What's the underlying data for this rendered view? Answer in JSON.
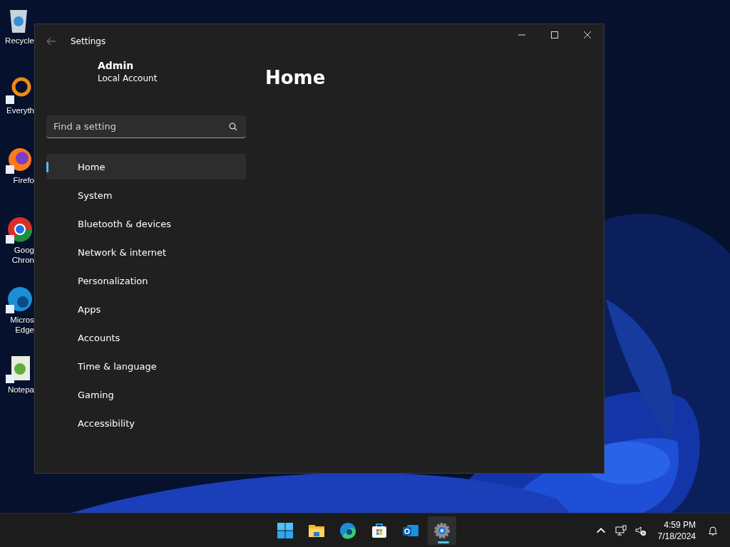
{
  "desktop_icons": [
    {
      "label": "Recycle",
      "kind": "bin"
    },
    {
      "label": "Everyth",
      "kind": "search"
    },
    {
      "label": "Firefo",
      "kind": "firefox"
    },
    {
      "label": "Goog Chron",
      "kind": "chrome"
    },
    {
      "label": "Micros Edge",
      "kind": "edge"
    },
    {
      "label": "Notepa",
      "kind": "notepad"
    }
  ],
  "window": {
    "title": "Settings",
    "user": {
      "name": "Admin",
      "account": "Local Account"
    },
    "search": {
      "placeholder": "Find a setting"
    },
    "nav": [
      {
        "label": "Home",
        "selected": true
      },
      {
        "label": "System",
        "selected": false
      },
      {
        "label": "Bluetooth & devices",
        "selected": false
      },
      {
        "label": "Network & internet",
        "selected": false
      },
      {
        "label": "Personalization",
        "selected": false
      },
      {
        "label": "Apps",
        "selected": false
      },
      {
        "label": "Accounts",
        "selected": false
      },
      {
        "label": "Time & language",
        "selected": false
      },
      {
        "label": "Gaming",
        "selected": false
      },
      {
        "label": "Accessibility",
        "selected": false
      }
    ],
    "page_title": "Home"
  },
  "taskbar": {
    "apps": [
      {
        "kind": "start",
        "selected": false
      },
      {
        "kind": "folder",
        "selected": false
      },
      {
        "kind": "edge",
        "selected": false
      },
      {
        "kind": "store",
        "selected": false
      },
      {
        "kind": "mail",
        "selected": false
      },
      {
        "kind": "settings",
        "selected": true
      }
    ],
    "time": "4:59 PM",
    "date": "7/18/2024"
  }
}
